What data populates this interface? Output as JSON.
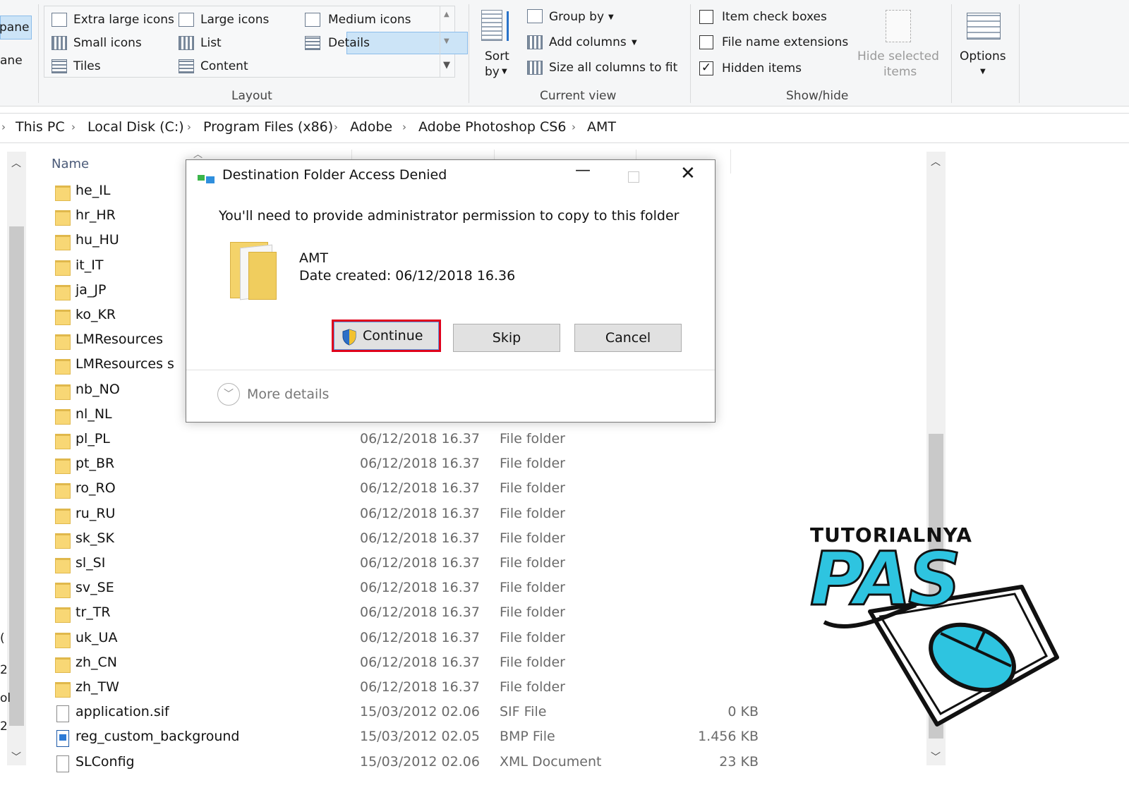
{
  "ribbon": {
    "pane_clip1": "pane",
    "pane_clip2": "ane",
    "layout": {
      "extra_large": "Extra large icons",
      "large": "Large icons",
      "medium": "Medium icons",
      "small": "Small icons",
      "list": "List",
      "details": "Details",
      "tiles": "Tiles",
      "content": "Content",
      "group_label": "Layout"
    },
    "current_view": {
      "sort_by_1": "Sort",
      "sort_by_2": "by",
      "group_by": "Group by",
      "add_columns": "Add columns",
      "size_columns": "Size all columns to fit",
      "group_label": "Current view"
    },
    "show_hide": {
      "item_check_boxes": "Item check boxes",
      "file_name_extensions": "File name extensions",
      "hidden_items": "Hidden items",
      "hide_selected_1": "Hide selected",
      "hide_selected_2": "items",
      "group_label": "Show/hide",
      "item_check_boxes_checked": false,
      "file_name_extensions_checked": false,
      "hidden_items_checked": true
    },
    "options": "Options"
  },
  "breadcrumb": [
    "This PC",
    "Local Disk (C:)",
    "Program Files (x86)",
    "Adobe",
    "Adobe Photoshop CS6",
    "AMT"
  ],
  "columns": {
    "name": "Name"
  },
  "files": [
    {
      "name": "he_IL",
      "kind": "folder",
      "date": "",
      "type": "",
      "size": ""
    },
    {
      "name": "hr_HR",
      "kind": "folder",
      "date": "",
      "type": "",
      "size": ""
    },
    {
      "name": "hu_HU",
      "kind": "folder",
      "date": "",
      "type": "",
      "size": ""
    },
    {
      "name": "it_IT",
      "kind": "folder",
      "date": "",
      "type": "",
      "size": ""
    },
    {
      "name": "ja_JP",
      "kind": "folder",
      "date": "",
      "type": "",
      "size": ""
    },
    {
      "name": "ko_KR",
      "kind": "folder",
      "date": "",
      "type": "",
      "size": ""
    },
    {
      "name": "LMResources",
      "kind": "folder",
      "date": "",
      "type": "",
      "size": ""
    },
    {
      "name": "LMResources s",
      "kind": "folder",
      "date": "",
      "type": "",
      "size": ""
    },
    {
      "name": "nb_NO",
      "kind": "folder",
      "date": "",
      "type": "",
      "size": ""
    },
    {
      "name": "nl_NL",
      "kind": "folder",
      "date": "",
      "type": "",
      "size": ""
    },
    {
      "name": "pl_PL",
      "kind": "folder",
      "date": "06/12/2018 16.37",
      "type": "File folder",
      "size": ""
    },
    {
      "name": "pt_BR",
      "kind": "folder",
      "date": "06/12/2018 16.37",
      "type": "File folder",
      "size": ""
    },
    {
      "name": "ro_RO",
      "kind": "folder",
      "date": "06/12/2018 16.37",
      "type": "File folder",
      "size": ""
    },
    {
      "name": "ru_RU",
      "kind": "folder",
      "date": "06/12/2018 16.37",
      "type": "File folder",
      "size": ""
    },
    {
      "name": "sk_SK",
      "kind": "folder",
      "date": "06/12/2018 16.37",
      "type": "File folder",
      "size": ""
    },
    {
      "name": "sl_SI",
      "kind": "folder",
      "date": "06/12/2018 16.37",
      "type": "File folder",
      "size": ""
    },
    {
      "name": "sv_SE",
      "kind": "folder",
      "date": "06/12/2018 16.37",
      "type": "File folder",
      "size": ""
    },
    {
      "name": "tr_TR",
      "kind": "folder",
      "date": "06/12/2018 16.37",
      "type": "File folder",
      "size": ""
    },
    {
      "name": "uk_UA",
      "kind": "folder",
      "date": "06/12/2018 16.37",
      "type": "File folder",
      "size": ""
    },
    {
      "name": "zh_CN",
      "kind": "folder",
      "date": "06/12/2018 16.37",
      "type": "File folder",
      "size": ""
    },
    {
      "name": "zh_TW",
      "kind": "folder",
      "date": "06/12/2018 16.37",
      "type": "File folder",
      "size": ""
    },
    {
      "name": "application.sif",
      "kind": "file",
      "date": "15/03/2012 02.06",
      "type": "SIF File",
      "size": "0 KB"
    },
    {
      "name": "reg_custom_background",
      "kind": "bmp",
      "date": "15/03/2012 02.05",
      "type": "BMP File",
      "size": "1.456 KB"
    },
    {
      "name": "SLConfig",
      "kind": "file",
      "date": "15/03/2012 02.06",
      "type": "XML Document",
      "size": "23 KB"
    }
  ],
  "nav_clips": [
    "(",
    "2",
    "ol",
    "2"
  ],
  "dialog": {
    "title": "Destination Folder Access Denied",
    "message": "You'll need to provide administrator permission to copy to this folder",
    "item_name": "AMT",
    "item_date": "Date created: 06/12/2018 16.36",
    "continue": "Continue",
    "skip": "Skip",
    "cancel": "Cancel",
    "more_details": "More details",
    "highlight_color": "#e0001b"
  },
  "watermark": {
    "top": "TUTORIALNYA",
    "big": "PAS",
    "color": "#2ec4e0"
  }
}
